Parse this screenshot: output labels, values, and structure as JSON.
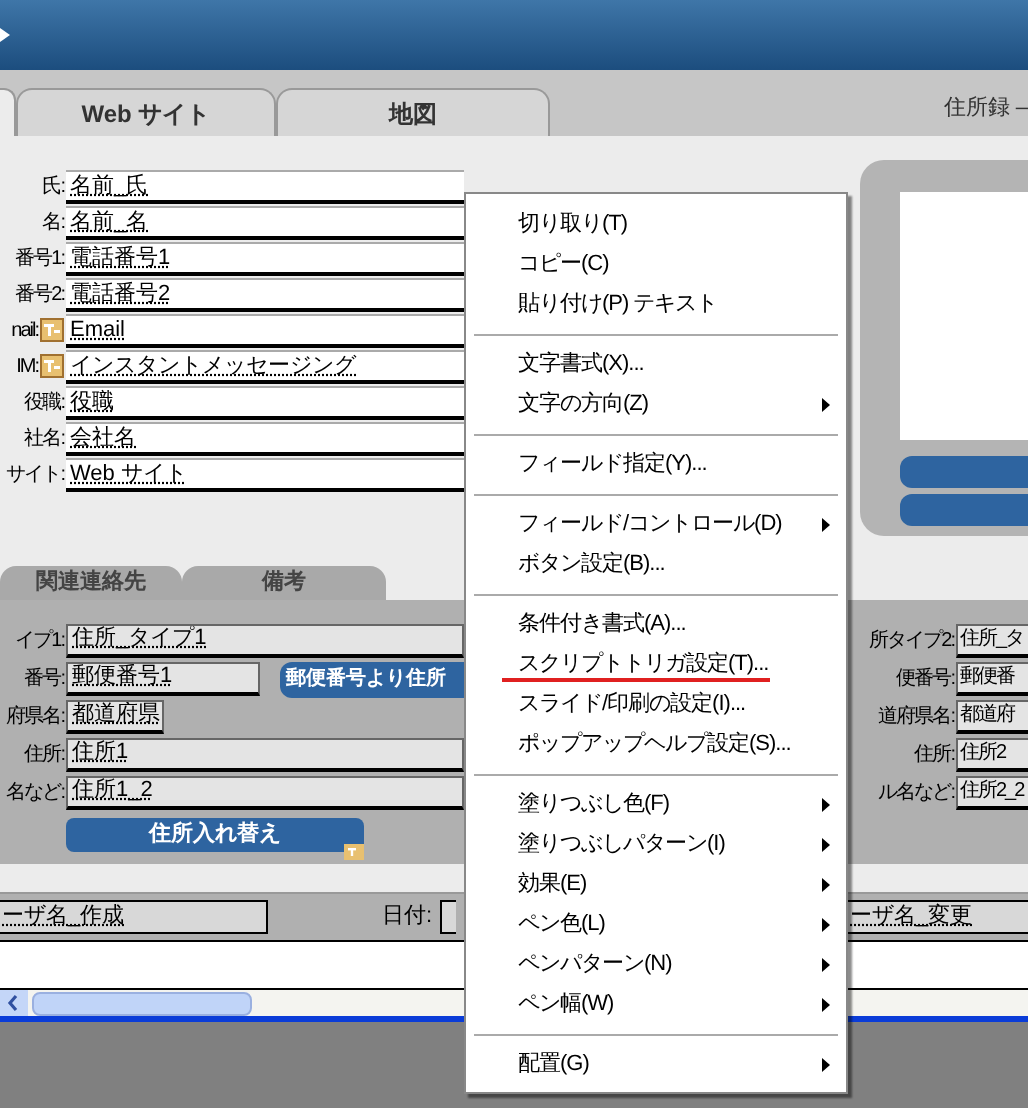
{
  "title": "住所録 –",
  "tabs": [
    {
      "label": "Web サイト",
      "selected": false
    },
    {
      "label": "地図",
      "selected": false
    }
  ],
  "contact_fields": [
    {
      "label": "氏:",
      "value": "名前_氏",
      "icon": false
    },
    {
      "label": "名:",
      "value": "名前_名",
      "icon": false
    },
    {
      "label": "番号1:",
      "value": "電話番号1",
      "icon": false
    },
    {
      "label": "番号2:",
      "value": "電話番号2",
      "icon": false
    },
    {
      "label": "nail:",
      "value": "Email",
      "icon": true
    },
    {
      "label": "IM:",
      "value": "インスタントメッセージング",
      "icon": true
    },
    {
      "label": "役職:",
      "value": "役職",
      "icon": false
    },
    {
      "label": "社名:",
      "value": "会社名",
      "icon": false
    },
    {
      "label": "サイト:",
      "value": "Web サイト",
      "icon": false
    }
  ],
  "lower_tabs": [
    {
      "label": "関連連絡先",
      "selected": false
    },
    {
      "label": "備考",
      "selected": false
    }
  ],
  "address_left": [
    {
      "label": "イプ1:",
      "value": "住所_タイプ1",
      "kind": "wide"
    },
    {
      "label": "番号:",
      "value": "郵便番号1",
      "kind": "medium",
      "button": "郵便番号より住所"
    },
    {
      "label": "府県名:",
      "value": "都道府県",
      "kind": "short"
    },
    {
      "label": "住所:",
      "value": "住所1",
      "kind": "wide"
    },
    {
      "label": "名など:",
      "value": "住所1_2",
      "kind": "wide"
    }
  ],
  "swap_button": "住所入れ替え",
  "address_right": [
    {
      "label": "所タイプ2:",
      "value": "住所_タ"
    },
    {
      "label": "便番号:",
      "value": "郵便番"
    },
    {
      "label": "道府県名:",
      "value": "都道府"
    },
    {
      "label": "住所:",
      "value": "住所2"
    },
    {
      "label": "ル名など:",
      "value": "住所2_2"
    }
  ],
  "footer": {
    "creator": "ーザ名_作成",
    "date_label": "日付:",
    "modifier": "ーザ名_変更"
  },
  "context_menu": [
    {
      "kind": "item",
      "label": "切り取り(T)",
      "submenu": false,
      "highlighted": false
    },
    {
      "kind": "item",
      "label": "コピー(C)",
      "submenu": false,
      "highlighted": false
    },
    {
      "kind": "item",
      "label": "貼り付け(P) テキスト",
      "submenu": false,
      "highlighted": false
    },
    {
      "kind": "separator"
    },
    {
      "kind": "item",
      "label": "文字書式(X)...",
      "submenu": false,
      "highlighted": false
    },
    {
      "kind": "item",
      "label": "文字の方向(Z)",
      "submenu": true,
      "highlighted": false
    },
    {
      "kind": "separator"
    },
    {
      "kind": "item",
      "label": "フィールド指定(Y)...",
      "submenu": false,
      "highlighted": false
    },
    {
      "kind": "separator"
    },
    {
      "kind": "item",
      "label": "フィールド/コントロール(D)",
      "submenu": true,
      "highlighted": false
    },
    {
      "kind": "item",
      "label": "ボタン設定(B)...",
      "submenu": false,
      "highlighted": false
    },
    {
      "kind": "separator"
    },
    {
      "kind": "item",
      "label": "条件付き書式(A)...",
      "submenu": false,
      "highlighted": false
    },
    {
      "kind": "item",
      "label": "スクリプトトリガ設定(T)...",
      "submenu": false,
      "highlighted": true
    },
    {
      "kind": "item",
      "label": "スライド/印刷の設定(I)...",
      "submenu": false,
      "highlighted": false
    },
    {
      "kind": "item",
      "label": "ポップアップヘルプ設定(S)...",
      "submenu": false,
      "highlighted": false
    },
    {
      "kind": "separator"
    },
    {
      "kind": "item",
      "label": "塗りつぶし色(F)",
      "submenu": true,
      "highlighted": false
    },
    {
      "kind": "item",
      "label": "塗りつぶしパターン(I)",
      "submenu": true,
      "highlighted": false
    },
    {
      "kind": "item",
      "label": "効果(E)",
      "submenu": true,
      "highlighted": false
    },
    {
      "kind": "item",
      "label": "ペン色(L)",
      "submenu": true,
      "highlighted": false
    },
    {
      "kind": "item",
      "label": "ペンパターン(N)",
      "submenu": true,
      "highlighted": false
    },
    {
      "kind": "item",
      "label": "ペン幅(W)",
      "submenu": true,
      "highlighted": false
    },
    {
      "kind": "separator"
    },
    {
      "kind": "item",
      "label": "配置(G)",
      "submenu": true,
      "highlighted": false
    }
  ]
}
